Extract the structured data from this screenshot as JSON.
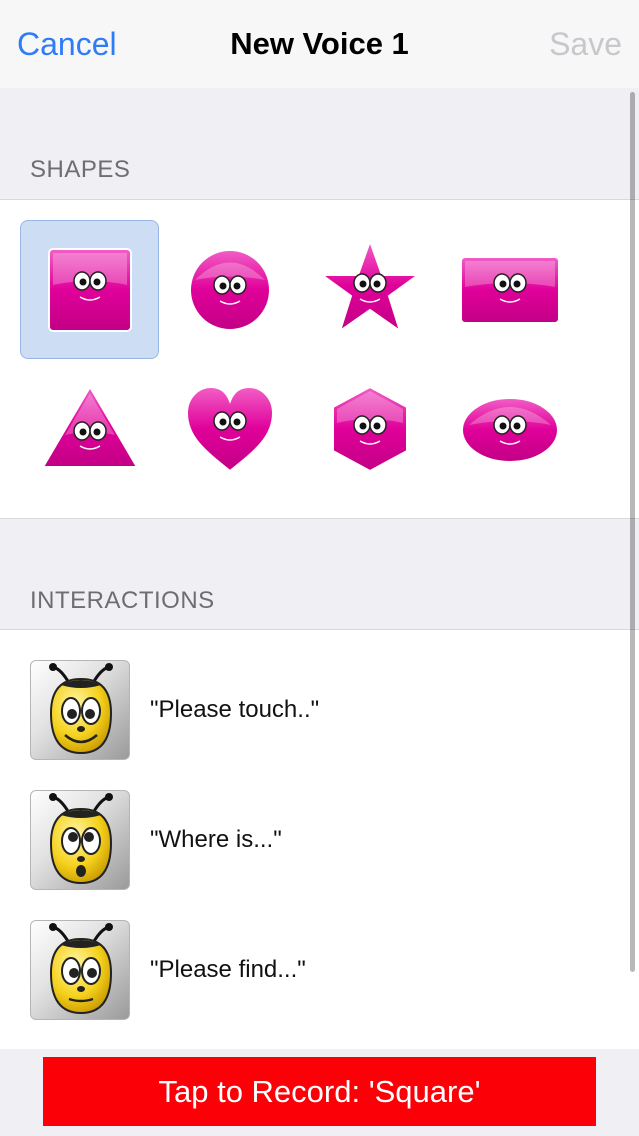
{
  "navbar": {
    "cancel_label": "Cancel",
    "title": "New Voice 1",
    "save_label": "Save"
  },
  "shapes": {
    "header": "SHAPES",
    "selected": "square",
    "items": [
      {
        "name": "square",
        "icon": "pink-square-face"
      },
      {
        "name": "circle",
        "icon": "pink-circle-face"
      },
      {
        "name": "star",
        "icon": "pink-star-face"
      },
      {
        "name": "rectangle",
        "icon": "pink-rectangle-face"
      },
      {
        "name": "triangle",
        "icon": "pink-triangle-face"
      },
      {
        "name": "heart",
        "icon": "pink-heart-face"
      },
      {
        "name": "hexagon",
        "icon": "pink-hexagon-face"
      },
      {
        "name": "oval",
        "icon": "pink-oval-face"
      }
    ]
  },
  "interactions": {
    "header": "INTERACTIONS",
    "items": [
      {
        "label": "\"Please touch..\"",
        "icon": "bee-face-icon"
      },
      {
        "label": "\"Where is...\"",
        "icon": "bee-face-icon"
      },
      {
        "label": "\"Please find...\"",
        "icon": "bee-face-icon"
      }
    ]
  },
  "record_button": {
    "label": "Tap to Record: 'Square'"
  },
  "colors": {
    "accent": "#2f7cf6",
    "shape_fill": "#e0009a",
    "record": "#fb0007",
    "selection": "#cdddf4"
  }
}
